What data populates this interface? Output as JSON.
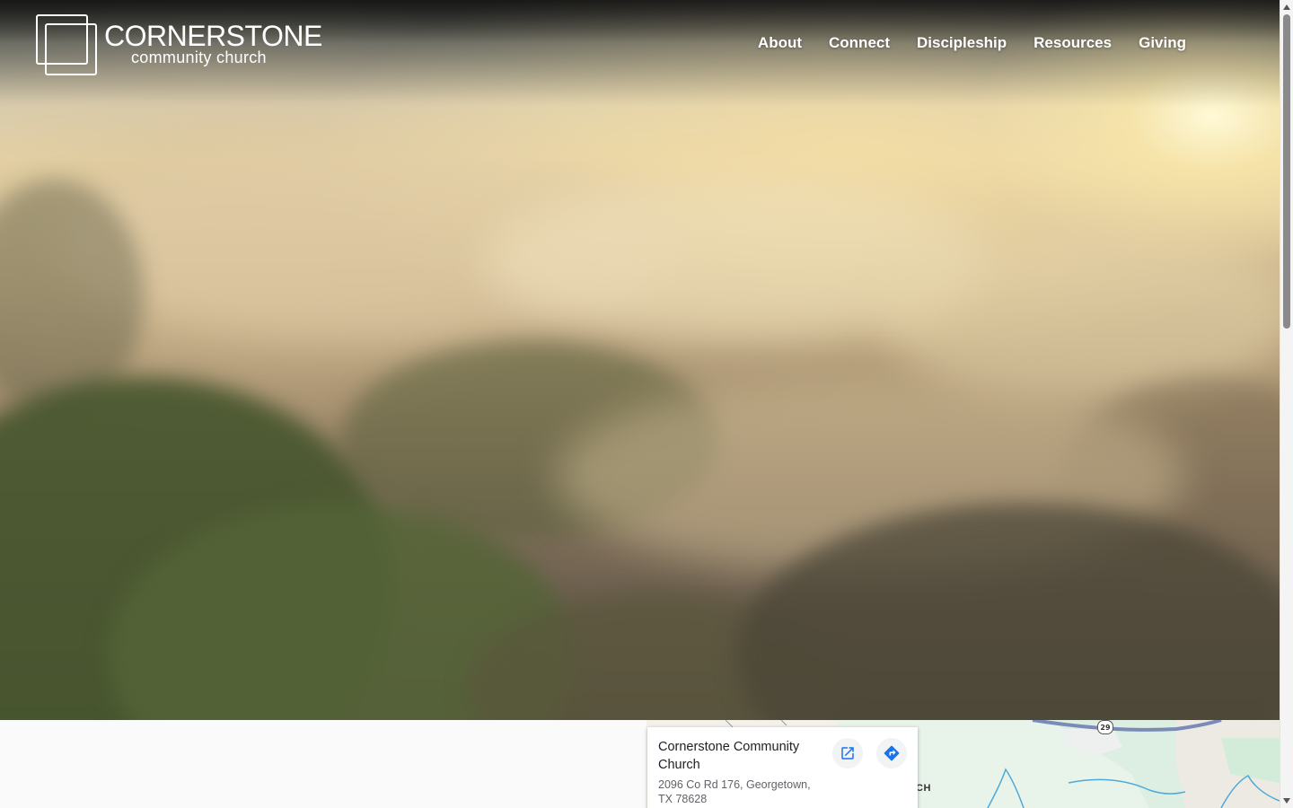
{
  "brand": {
    "name": "CORNERSTONE",
    "tagline": "community church"
  },
  "nav": {
    "items": [
      {
        "label": "About"
      },
      {
        "label": "Connect"
      },
      {
        "label": "Discipleship"
      },
      {
        "label": "Resources"
      },
      {
        "label": "Giving"
      }
    ]
  },
  "map": {
    "place_name": "Cornerstone Community Church",
    "address": "2096 Co Rd 176, Georgetown, TX 78628",
    "route_number": "29",
    "partial_label": "CH",
    "open_icon": "open-in-new-icon",
    "directions_icon": "directions-icon"
  },
  "colors": {
    "nav_text": "#ffffff",
    "map_button_icon": "#1a73e8",
    "map_water": "#4fa9d8",
    "map_road": "#7b8bb8"
  }
}
